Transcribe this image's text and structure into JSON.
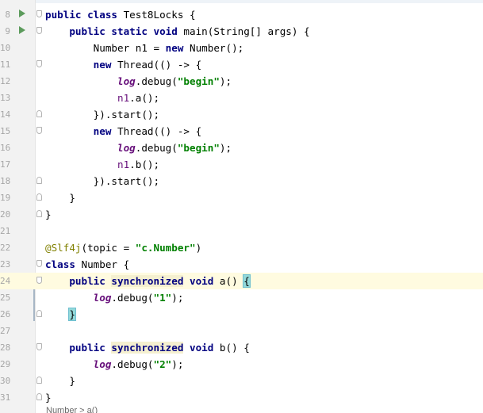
{
  "editor": {
    "breadcrumb": "Number > a()",
    "lines": [
      {
        "n": "8",
        "run": true,
        "fold": "open",
        "tokens": [
          [
            "kw",
            "public class "
          ],
          [
            "plain",
            "Test8Locks {"
          ]
        ]
      },
      {
        "n": "9",
        "run": true,
        "fold": "open",
        "tokens": [
          [
            "plain",
            "    "
          ],
          [
            "kw",
            "public static void "
          ],
          [
            "plain",
            "main(String[] args) {"
          ]
        ]
      },
      {
        "n": "10",
        "tokens": [
          [
            "plain",
            "        Number n1 = "
          ],
          [
            "kw",
            "new "
          ],
          [
            "plain",
            "Number();"
          ]
        ]
      },
      {
        "n": "11",
        "fold": "open",
        "tokens": [
          [
            "plain",
            "        "
          ],
          [
            "kw",
            "new "
          ],
          [
            "plain",
            "Thread(() -> {"
          ]
        ]
      },
      {
        "n": "12",
        "tokens": [
          [
            "plain",
            "            "
          ],
          [
            "static-field",
            "log"
          ],
          [
            "plain",
            ".debug("
          ],
          [
            "str",
            "\"begin\""
          ],
          [
            "plain",
            ");"
          ]
        ]
      },
      {
        "n": "13",
        "tokens": [
          [
            "plain",
            "            "
          ],
          [
            "field",
            "n1"
          ],
          [
            "plain",
            ".a();"
          ]
        ]
      },
      {
        "n": "14",
        "fold": "close",
        "tokens": [
          [
            "plain",
            "        }).start();"
          ]
        ]
      },
      {
        "n": "15",
        "fold": "open",
        "tokens": [
          [
            "plain",
            "        "
          ],
          [
            "kw",
            "new "
          ],
          [
            "plain",
            "Thread(() -> {"
          ]
        ]
      },
      {
        "n": "16",
        "tokens": [
          [
            "plain",
            "            "
          ],
          [
            "static-field",
            "log"
          ],
          [
            "plain",
            ".debug("
          ],
          [
            "str",
            "\"begin\""
          ],
          [
            "plain",
            ");"
          ]
        ]
      },
      {
        "n": "17",
        "tokens": [
          [
            "plain",
            "            "
          ],
          [
            "field",
            "n1"
          ],
          [
            "plain",
            ".b();"
          ]
        ]
      },
      {
        "n": "18",
        "fold": "close",
        "tokens": [
          [
            "plain",
            "        }).start();"
          ]
        ]
      },
      {
        "n": "19",
        "fold": "close",
        "tokens": [
          [
            "plain",
            "    }"
          ]
        ]
      },
      {
        "n": "20",
        "fold": "close",
        "tokens": [
          [
            "plain",
            "}"
          ]
        ]
      },
      {
        "n": "21",
        "tokens": []
      },
      {
        "n": "22",
        "tokens": [
          [
            "ann",
            "@Slf4j"
          ],
          [
            "plain",
            "(topic = "
          ],
          [
            "str",
            "\"c.Number\""
          ],
          [
            "plain",
            ")"
          ]
        ]
      },
      {
        "n": "23",
        "fold": "open",
        "tokens": [
          [
            "kw",
            "class "
          ],
          [
            "plain",
            "Number {"
          ]
        ]
      },
      {
        "n": "24",
        "current": true,
        "fold": "open",
        "tokens": [
          [
            "plain",
            "    "
          ],
          [
            "kw",
            "public "
          ],
          [
            "kw syncbg",
            "synchronized"
          ],
          [
            "kw",
            " void "
          ],
          [
            "plain",
            "a() "
          ],
          [
            "brace-hl",
            "{"
          ]
        ]
      },
      {
        "n": "25",
        "current": false,
        "tokens": [
          [
            "plain",
            "        "
          ],
          [
            "static-field",
            "log"
          ],
          [
            "plain",
            ".debug("
          ],
          [
            "str",
            "\"1\""
          ],
          [
            "plain",
            ");"
          ]
        ]
      },
      {
        "n": "26",
        "fold": "close",
        "tokens": [
          [
            "plain",
            "    "
          ],
          [
            "brace-hl",
            "}"
          ]
        ]
      },
      {
        "n": "27",
        "tokens": []
      },
      {
        "n": "28",
        "fold": "open",
        "tokens": [
          [
            "plain",
            "    "
          ],
          [
            "kw",
            "public "
          ],
          [
            "kw syncbg",
            "synchronized"
          ],
          [
            "kw",
            " void "
          ],
          [
            "plain",
            "b() {"
          ]
        ]
      },
      {
        "n": "29",
        "tokens": [
          [
            "plain",
            "        "
          ],
          [
            "static-field",
            "log"
          ],
          [
            "plain",
            ".debug("
          ],
          [
            "str",
            "\"2\""
          ],
          [
            "plain",
            ");"
          ]
        ]
      },
      {
        "n": "30",
        "fold": "close",
        "tokens": [
          [
            "plain",
            "    }"
          ]
        ]
      },
      {
        "n": "31",
        "fold": "close",
        "tokens": [
          [
            "plain",
            "}"
          ]
        ]
      }
    ]
  }
}
